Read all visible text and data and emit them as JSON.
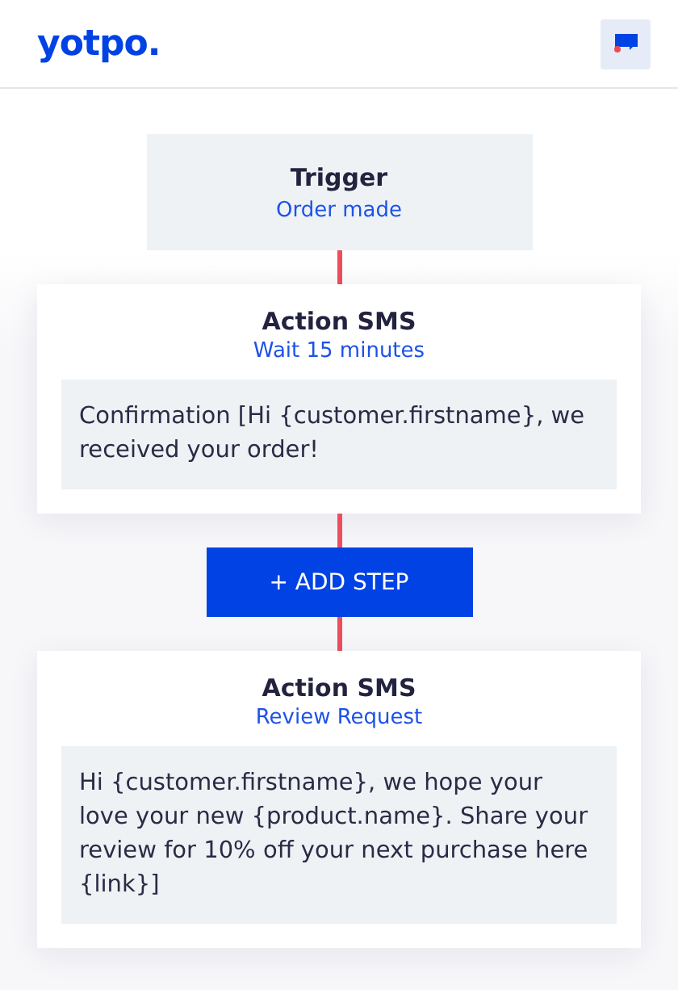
{
  "header": {
    "logo": "yotpo."
  },
  "flow": [
    {
      "kind": "trigger",
      "title": "Trigger",
      "subtitle": "Order made"
    },
    {
      "kind": "action",
      "title": "Action SMS",
      "subtitle": "Wait 15 minutes",
      "message": "Confirmation [Hi {customer.firstname}, we received your order!"
    },
    {
      "kind": "add_step",
      "label": "+ ADD STEP"
    },
    {
      "kind": "action",
      "title": "Action SMS",
      "subtitle": "Review Request",
      "message": "Hi {customer.firstname}, we hope your love your new {product.name}. Share your review for 10% off your next purchase here {link}]"
    }
  ]
}
